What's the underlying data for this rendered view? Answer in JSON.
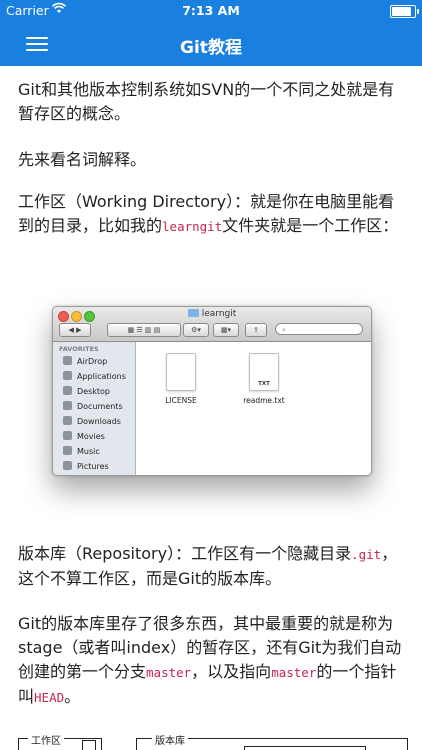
{
  "status_bar": {
    "carrier": "Carrier",
    "time": "7:13 AM"
  },
  "nav": {
    "title": "Git教程"
  },
  "article": {
    "p1": "Git和其他版本控制系统如SVN的一个不同之处就是有暂存区的概念。",
    "p2": "先来看名词解释。",
    "p3_a": "工作区（Working Directory）：就是你在电脑里能看到的目录，比如我的",
    "p3_code": "learngit",
    "p3_b": "文件夹就是一个工作区：",
    "p4_a": "版本库（Repository）：工作区有一个隐藏目录",
    "p4_code": ".git",
    "p4_b": "，这个不算工作区，而是Git的版本库。",
    "p5_a": "Git的版本库里存了很多东西，其中最重要的就是称为stage（或者叫index）的暂存区，还有Git为我们自动创建的第一个分支",
    "p5_code1": "master",
    "p5_b": "，以及指向",
    "p5_code2": "master",
    "p5_c": "的一个指针叫",
    "p5_code3": "HEAD",
    "p5_d": "。"
  },
  "finder": {
    "window_title": "learngit",
    "sidebar_heading": "FAVORITES",
    "sidebar_items": [
      {
        "label": "AirDrop",
        "icon": "airdrop-icon"
      },
      {
        "label": "Applications",
        "icon": "applications-icon"
      },
      {
        "label": "Desktop",
        "icon": "desktop-icon"
      },
      {
        "label": "Documents",
        "icon": "documents-icon"
      },
      {
        "label": "Downloads",
        "icon": "downloads-icon"
      },
      {
        "label": "Movies",
        "icon": "movies-icon"
      },
      {
        "label": "Music",
        "icon": "music-icon"
      },
      {
        "label": "Pictures",
        "icon": "pictures-icon"
      }
    ],
    "files": [
      {
        "name": "LICENSE",
        "badge": ""
      },
      {
        "name": "readme.txt",
        "badge": "TXT"
      }
    ]
  },
  "diagram": {
    "workspace_label": "工作区",
    "repo_label": "版本库"
  },
  "colors": {
    "nav_bg": "#1a80e0",
    "code_text": "#c7254e"
  }
}
